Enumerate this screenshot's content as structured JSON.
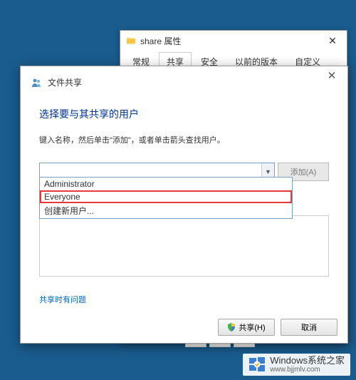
{
  "props": {
    "title": "share 属性",
    "tabs": [
      "常规",
      "共享",
      "安全",
      "以前的版本",
      "自定义"
    ],
    "active_tab": 1
  },
  "share": {
    "header": "文件共享",
    "title": "选择要与其共享的用户",
    "hint": "键入名称，然后单击\"添加\"，或者单击箭头查找用户。",
    "input_value": "",
    "add_button": "添加(A)",
    "dropdown_items": [
      "Administrator",
      "Everyone",
      "创建新用户..."
    ],
    "highlighted_index": 1,
    "help_link": "共享时有问题",
    "share_button": "共享(H)",
    "cancel_button": "取消"
  },
  "watermark": {
    "brand": "Windows系统之家",
    "url": "www.bjjmlv.com"
  }
}
